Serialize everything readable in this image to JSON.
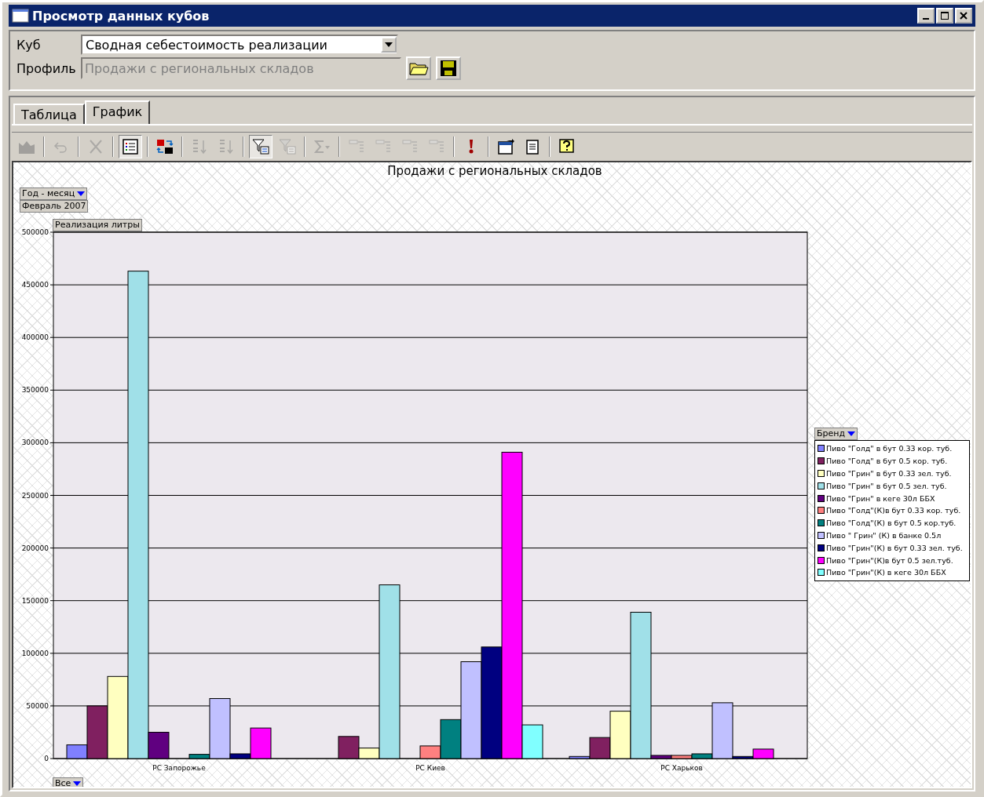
{
  "window": {
    "title": "Просмотр данных кубов"
  },
  "form": {
    "cube_label": "Куб",
    "cube_value": "Сводная себестоимость реализации",
    "profile_label": "Профиль",
    "profile_value": "Продажи с региональных складов",
    "profile_disabled": true
  },
  "tabs": [
    {
      "label": "Таблица",
      "selected": false
    },
    {
      "label": "График",
      "selected": true
    }
  ],
  "toolbar": [
    [
      {
        "kind": "chart",
        "disabled": true,
        "pressed": false
      }
    ],
    [
      {
        "kind": "undo",
        "disabled": true,
        "pressed": false
      }
    ],
    [
      {
        "kind": "delete",
        "disabled": true,
        "pressed": false
      }
    ],
    [
      {
        "kind": "legend",
        "disabled": false,
        "pressed": true
      }
    ],
    [
      {
        "kind": "pivot",
        "disabled": false,
        "pressed": false
      }
    ],
    [
      {
        "kind": "sort-asc",
        "disabled": true,
        "pressed": false
      },
      {
        "kind": "sort-desc",
        "disabled": true,
        "pressed": false
      }
    ],
    [
      {
        "kind": "filter",
        "disabled": false,
        "pressed": true
      },
      {
        "kind": "filter-top",
        "disabled": true,
        "pressed": false
      }
    ],
    [
      {
        "kind": "sum",
        "disabled": true,
        "pressed": false
      }
    ],
    [
      {
        "kind": "field",
        "disabled": true,
        "pressed": false
      },
      {
        "kind": "field",
        "disabled": true,
        "pressed": false
      },
      {
        "kind": "field",
        "disabled": true,
        "pressed": false
      },
      {
        "kind": "field",
        "disabled": true,
        "pressed": false
      }
    ],
    [
      {
        "kind": "alert",
        "disabled": false,
        "pressed": false
      }
    ],
    [
      {
        "kind": "export",
        "disabled": false,
        "pressed": false
      },
      {
        "kind": "report",
        "disabled": false,
        "pressed": false
      }
    ],
    [
      {
        "kind": "help",
        "disabled": false,
        "pressed": false
      }
    ]
  ],
  "chart": {
    "filter_field": "Год - месяц",
    "filter_value": "Февраль 2007",
    "series_field": "Бренд",
    "category_field": "Все",
    "chart_data": {
      "type": "bar",
      "grid": true,
      "legend": true,
      "title": "Продажи с региональных складов",
      "ylabel": "Реализация литры",
      "categories": [
        "РС Запорожье",
        "РС Киев",
        "РС Харьков"
      ],
      "ylim": [
        0,
        500000
      ],
      "yticks": [
        0,
        50000,
        100000,
        150000,
        200000,
        250000,
        300000,
        350000,
        400000,
        450000,
        500000
      ],
      "series": [
        {
          "name": "Пиво \"Голд\" в бут 0.33 кор. туб.",
          "color": "#8080ff",
          "values": [
            13000,
            null,
            2000
          ]
        },
        {
          "name": "Пиво \"Голд\" в бут 0.5 кор. туб.",
          "color": "#802060",
          "values": [
            50000,
            21000,
            20000
          ]
        },
        {
          "name": "Пиво \"Грин\" в бут 0.33 зел. туб.",
          "color": "#ffffc0",
          "values": [
            78000,
            10000,
            45000
          ]
        },
        {
          "name": "Пиво \"Грин\" в бут 0.5 зел. туб.",
          "color": "#a0e0e8",
          "values": [
            463000,
            165000,
            139000
          ]
        },
        {
          "name": "Пиво \"Грин\"  в кеге 30л ББХ",
          "color": "#600080",
          "values": [
            25000,
            null,
            3000
          ]
        },
        {
          "name": "Пиво \"Голд\"(К)в бут 0.33 кор. туб.",
          "color": "#ff8080",
          "values": [
            null,
            12000,
            3000
          ]
        },
        {
          "name": "Пиво \"Голд\"(К) в бут 0.5 кор.туб.",
          "color": "#008080",
          "values": [
            4000,
            37000,
            4500
          ]
        },
        {
          "name": "Пиво \" Грин\" (К) в банке 0.5л",
          "color": "#c0c0ff",
          "values": [
            57000,
            92000,
            53000
          ]
        },
        {
          "name": "Пиво \"Грин\"(К) в бут 0.33 зел. туб.",
          "color": "#000080",
          "values": [
            4500,
            106000,
            2000
          ]
        },
        {
          "name": "Пиво \"Грин\"(К)в бут 0.5 зел.туб.",
          "color": "#ff00ff",
          "values": [
            29000,
            291000,
            9000
          ]
        },
        {
          "name": "Пиво \"Грин\"(К)  в кеге 30л ББХ",
          "color": "#80ffff",
          "values": [
            null,
            32000,
            null
          ]
        }
      ]
    }
  }
}
